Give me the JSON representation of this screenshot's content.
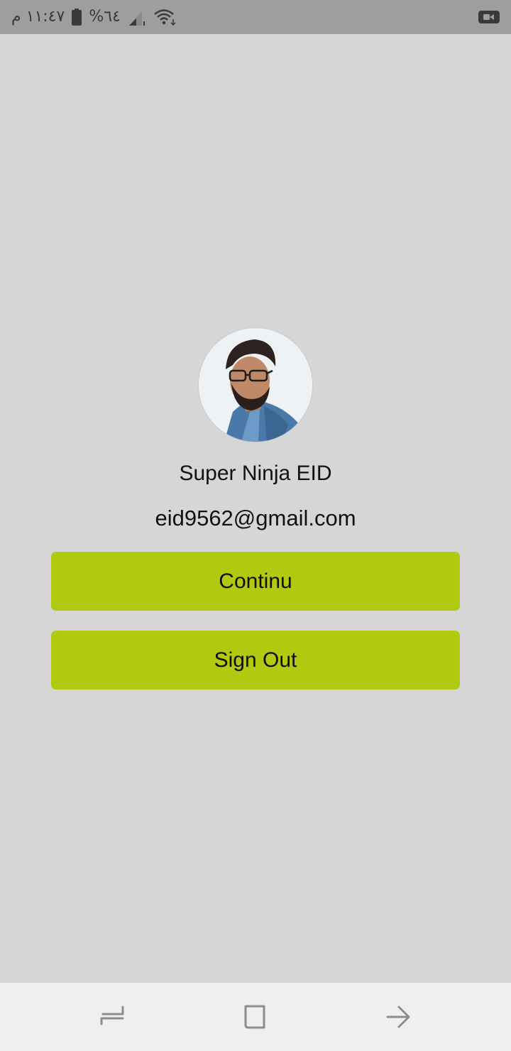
{
  "status_bar": {
    "time": "١١:٤٧ م",
    "battery_percent": "%٦٤",
    "icons": [
      "battery-icon",
      "signal-icon",
      "wifi-icon",
      "video-call-icon"
    ],
    "background_color": "#9e9e9e"
  },
  "profile": {
    "avatar_icon": "profile-photo",
    "name": "Super Ninja EID",
    "email": "eid9562@gmail.com"
  },
  "actions": {
    "continue_label": "Continu",
    "signout_label": "Sign Out",
    "button_color": "#b1ca0f"
  },
  "nav_bar": {
    "icons": [
      "recents-icon",
      "home-icon",
      "back-icon"
    ],
    "background_color": "#efefef"
  },
  "colors": {
    "page_background": "#d6d6d6"
  }
}
